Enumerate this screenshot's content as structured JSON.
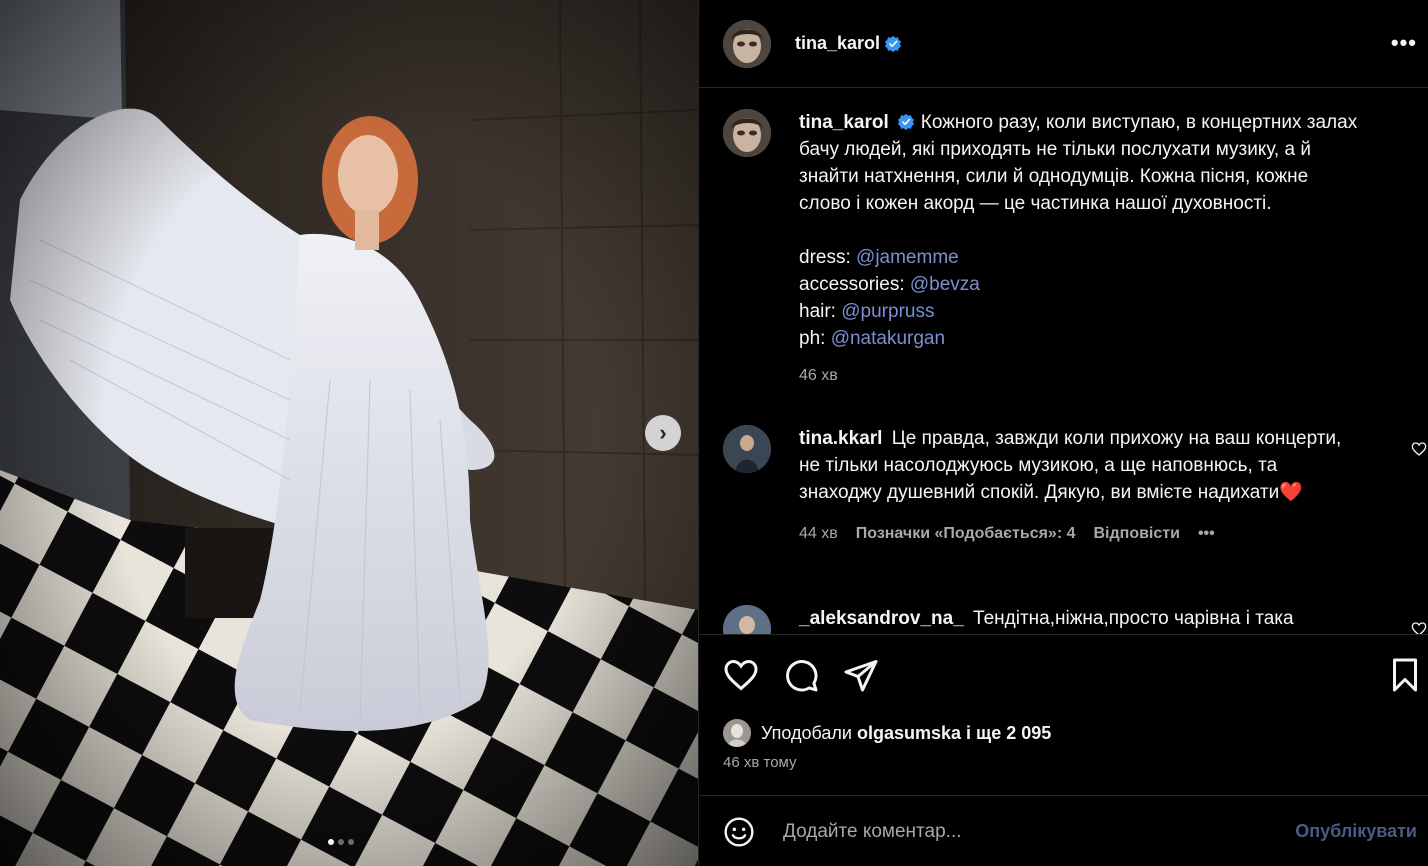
{
  "post": {
    "author": "tina_karol",
    "more_label": "•••",
    "caption_main": "Кожного разу, коли виступаю, в концертних залах бачу людей, які приходять не тільки послухати музику, а й знайти натхнення, сили й однодумців. Кожна пісня, кожне слово і кожен акорд — це частинка нашої духовності.",
    "credits": [
      {
        "label": "dress:",
        "mention": "@jamemme"
      },
      {
        "label": "accessories:",
        "mention": "@bevza"
      },
      {
        "label": "hair:",
        "mention": "@purpruss"
      },
      {
        "label": "ph:",
        "mention": "@natakurgan"
      }
    ],
    "caption_time": "46 хв",
    "carousel": {
      "current": 1,
      "total": 3
    },
    "next_label": "›"
  },
  "comments": [
    {
      "username": "tina.kkarl",
      "text": "Це правда, завжди коли прихожу на ваш концерти, не тільки насолоджуюсь музикою, а ще наповнюсь, та знаходжу душевний спокій. Дякую, ви вмієте надихати",
      "emoji": "❤️",
      "time": "44 хв",
      "likes": "Позначки «Подобається»: 4",
      "reply": "Відповісти",
      "more": "•••"
    },
    {
      "username": "_aleksandrov_na_",
      "text": "Тендітна,ніжна,просто чарівна і така"
    }
  ],
  "likes": {
    "prefix": "Уподобали",
    "user": "olgasumska",
    "suffix": "і ще 2 095"
  },
  "timestamp": "46 хв тому",
  "comment_box": {
    "placeholder": "Додайте коментар...",
    "publish": "Опублікувати"
  },
  "icons": [
    "heart-icon",
    "comment-icon",
    "share-icon",
    "bookmark-icon",
    "emoji-icon",
    "verified-icon",
    "chevron-right-icon"
  ],
  "colors": {
    "background": "#000000",
    "text": "#f5f5f5",
    "secondary": "#a8a8a8",
    "mention": "#7b8fd1",
    "verified": "#3897f0",
    "publish": "#4c5a85",
    "like_heart": "#ed4956"
  }
}
